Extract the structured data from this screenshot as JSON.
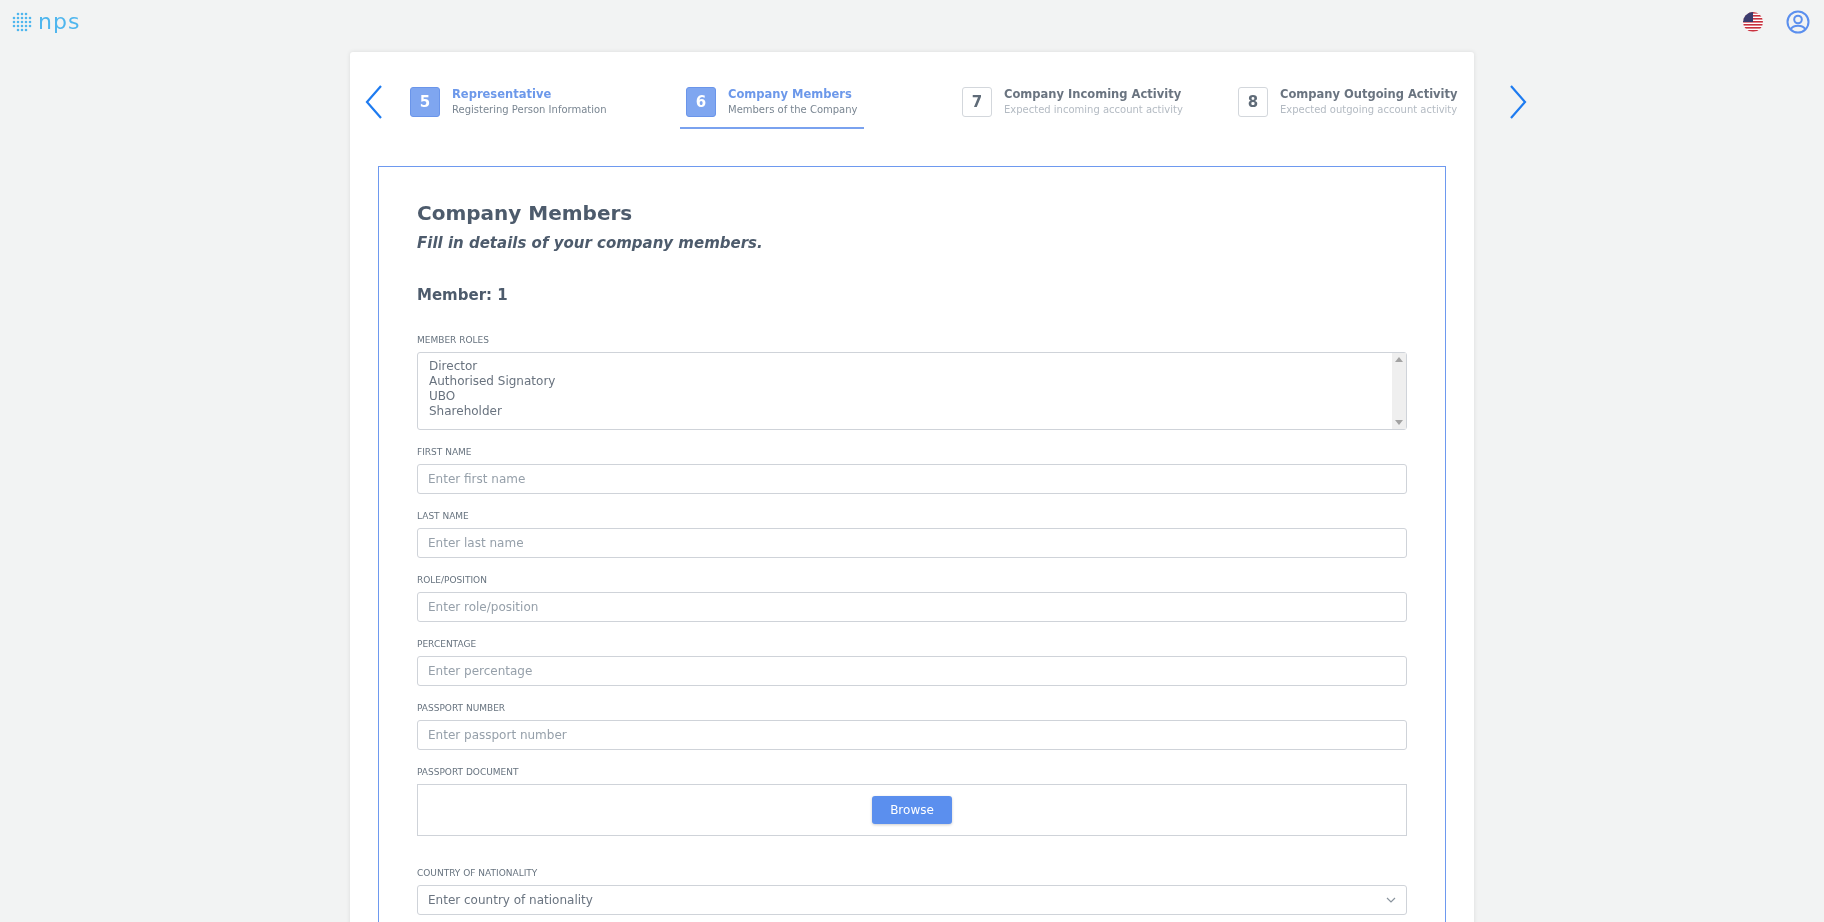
{
  "header": {
    "logo": "nps"
  },
  "steps": [
    {
      "number": "5",
      "title": "Representative",
      "subtitle": "Registering Person Information",
      "completed": true,
      "selected": false
    },
    {
      "number": "6",
      "title": "Company Members",
      "subtitle": "Members of the Company",
      "completed": true,
      "selected": true
    },
    {
      "number": "7",
      "title": "Company Incoming Activity",
      "subtitle": "Expected incoming account activity",
      "completed": false,
      "selected": false
    },
    {
      "number": "8",
      "title": "Company Outgoing Activity",
      "subtitle": "Expected outgoing account activity",
      "completed": false,
      "selected": false
    }
  ],
  "form": {
    "title": "Company Members",
    "subtitle": "Fill in details of your company members.",
    "member_heading": "Member: 1",
    "fields": [
      {
        "kind": "multiselect",
        "label": "MEMBER ROLES",
        "options": [
          "Director",
          "Authorised Signatory",
          "UBO",
          "Shareholder"
        ]
      },
      {
        "kind": "text",
        "label": "FIRST NAME",
        "placeholder": "Enter first name"
      },
      {
        "kind": "text",
        "label": "LAST NAME",
        "placeholder": "Enter last name"
      },
      {
        "kind": "text",
        "label": "ROLE/POSITION",
        "placeholder": "Enter role/position"
      },
      {
        "kind": "text",
        "label": "PERCENTAGE",
        "placeholder": "Enter percentage"
      },
      {
        "kind": "text",
        "label": "PASSPORT NUMBER",
        "placeholder": "Enter passport number"
      },
      {
        "kind": "file",
        "label": "PASSPORT DOCUMENT",
        "button": "Browse"
      },
      {
        "kind": "select",
        "label": "COUNTRY OF NATIONALITY",
        "placeholder": "Enter country of nationality"
      }
    ]
  }
}
